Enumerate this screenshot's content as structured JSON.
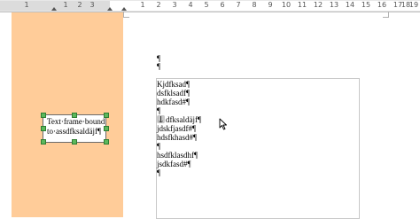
{
  "ruler": {
    "numbers": [
      "1",
      "1",
      "2",
      "3",
      "1",
      "2",
      "3",
      "4",
      "5",
      "6",
      "7",
      "8",
      "9",
      "10",
      "11",
      "12",
      "13",
      "14",
      "15",
      "16",
      "17",
      "18",
      "19"
    ]
  },
  "small_frame": {
    "lines": [
      "Text·frame·bound",
      "to·assdfksaldäjf¶"
    ]
  },
  "pilcrows_above": [
    "¶",
    "¶"
  ],
  "big_frame": {
    "lines": [
      "Kjdfksad¶",
      "dsfklsadf¶",
      "hdkfasd#¶",
      "¶",
      "dfksaldäjf¶",
      "jdskfjasdf#¶",
      "hdsfkhasd#¶",
      "¶",
      "hsdfklasdhf¶",
      "jsdkfasd#¶",
      "¶"
    ]
  },
  "colors": {
    "margin": "#ffcc99",
    "frame_handle": "#5cb85c"
  }
}
